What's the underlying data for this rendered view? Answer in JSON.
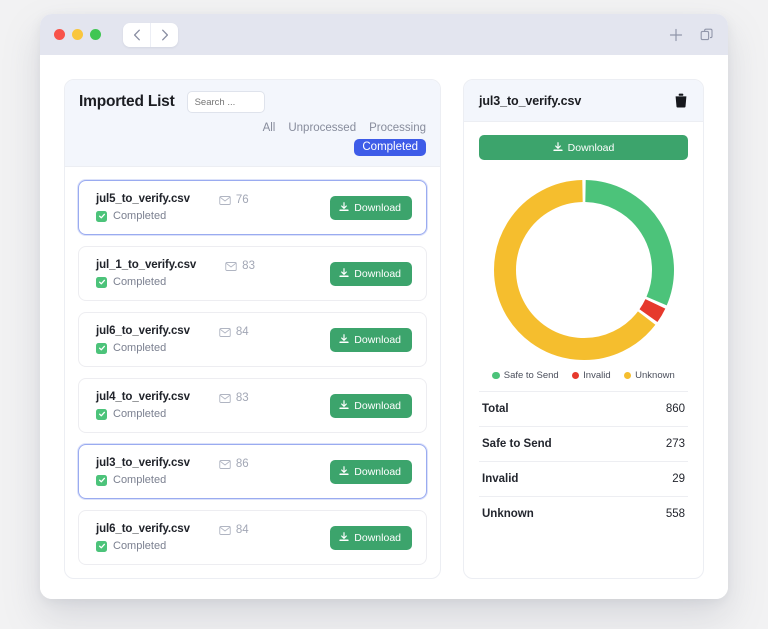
{
  "window": {
    "traffic_lights": [
      "close",
      "minimize",
      "maximize"
    ],
    "back_icon": "chevron-left-icon",
    "forward_icon": "chevron-right-icon",
    "new_tab_icon": "plus-icon",
    "tabs_icon": "copy-tabs-icon"
  },
  "left_panel": {
    "title": "Imported List",
    "search": {
      "placeholder": "Search ...",
      "value": ""
    },
    "filters": [
      {
        "label": "All",
        "active": false
      },
      {
        "label": "Unprocessed",
        "active": false
      },
      {
        "label": "Processing",
        "active": false
      },
      {
        "label": "Completed",
        "active": true
      }
    ],
    "download_label": "Download",
    "files": [
      {
        "name": "jul5_to_verify.csv",
        "count": "76",
        "status": "Completed",
        "selected": true
      },
      {
        "name": "jul_1_to_verify.csv",
        "count": "83",
        "status": "Completed",
        "selected": false
      },
      {
        "name": "jul6_to_verify.csv",
        "count": "84",
        "status": "Completed",
        "selected": false
      },
      {
        "name": "jul4_to_verify.csv",
        "count": "83",
        "status": "Completed",
        "selected": false
      },
      {
        "name": "jul3_to_verify.csv",
        "count": "86",
        "status": "Completed",
        "selected": true
      },
      {
        "name": "jul6_to_verify.csv",
        "count": "84",
        "status": "Completed",
        "selected": false
      }
    ]
  },
  "right_panel": {
    "title": "jul3_to_verify.csv",
    "delete_icon": "trash-icon",
    "download_label": "Download",
    "stats": [
      {
        "label": "Total",
        "value": "860"
      },
      {
        "label": "Safe to Send",
        "value": "273"
      },
      {
        "label": "Invalid",
        "value": "29"
      },
      {
        "label": "Unknown",
        "value": "558"
      }
    ]
  },
  "chart_data": {
    "type": "pie",
    "title": "",
    "categories": [
      "Safe to Send",
      "Invalid",
      "Unknown"
    ],
    "values": [
      273,
      29,
      558
    ],
    "total": 860,
    "colors": [
      "#4cc37a",
      "#e6392c",
      "#f5be2e"
    ],
    "legend_position": "bottom",
    "donut": true,
    "start_angle": 0
  },
  "colors": {
    "accent_blue": "#3e5ce8",
    "green": "#3ca46c",
    "chart_green": "#4cc37a",
    "chart_red": "#e6392c",
    "chart_yellow": "#f5be2e"
  }
}
